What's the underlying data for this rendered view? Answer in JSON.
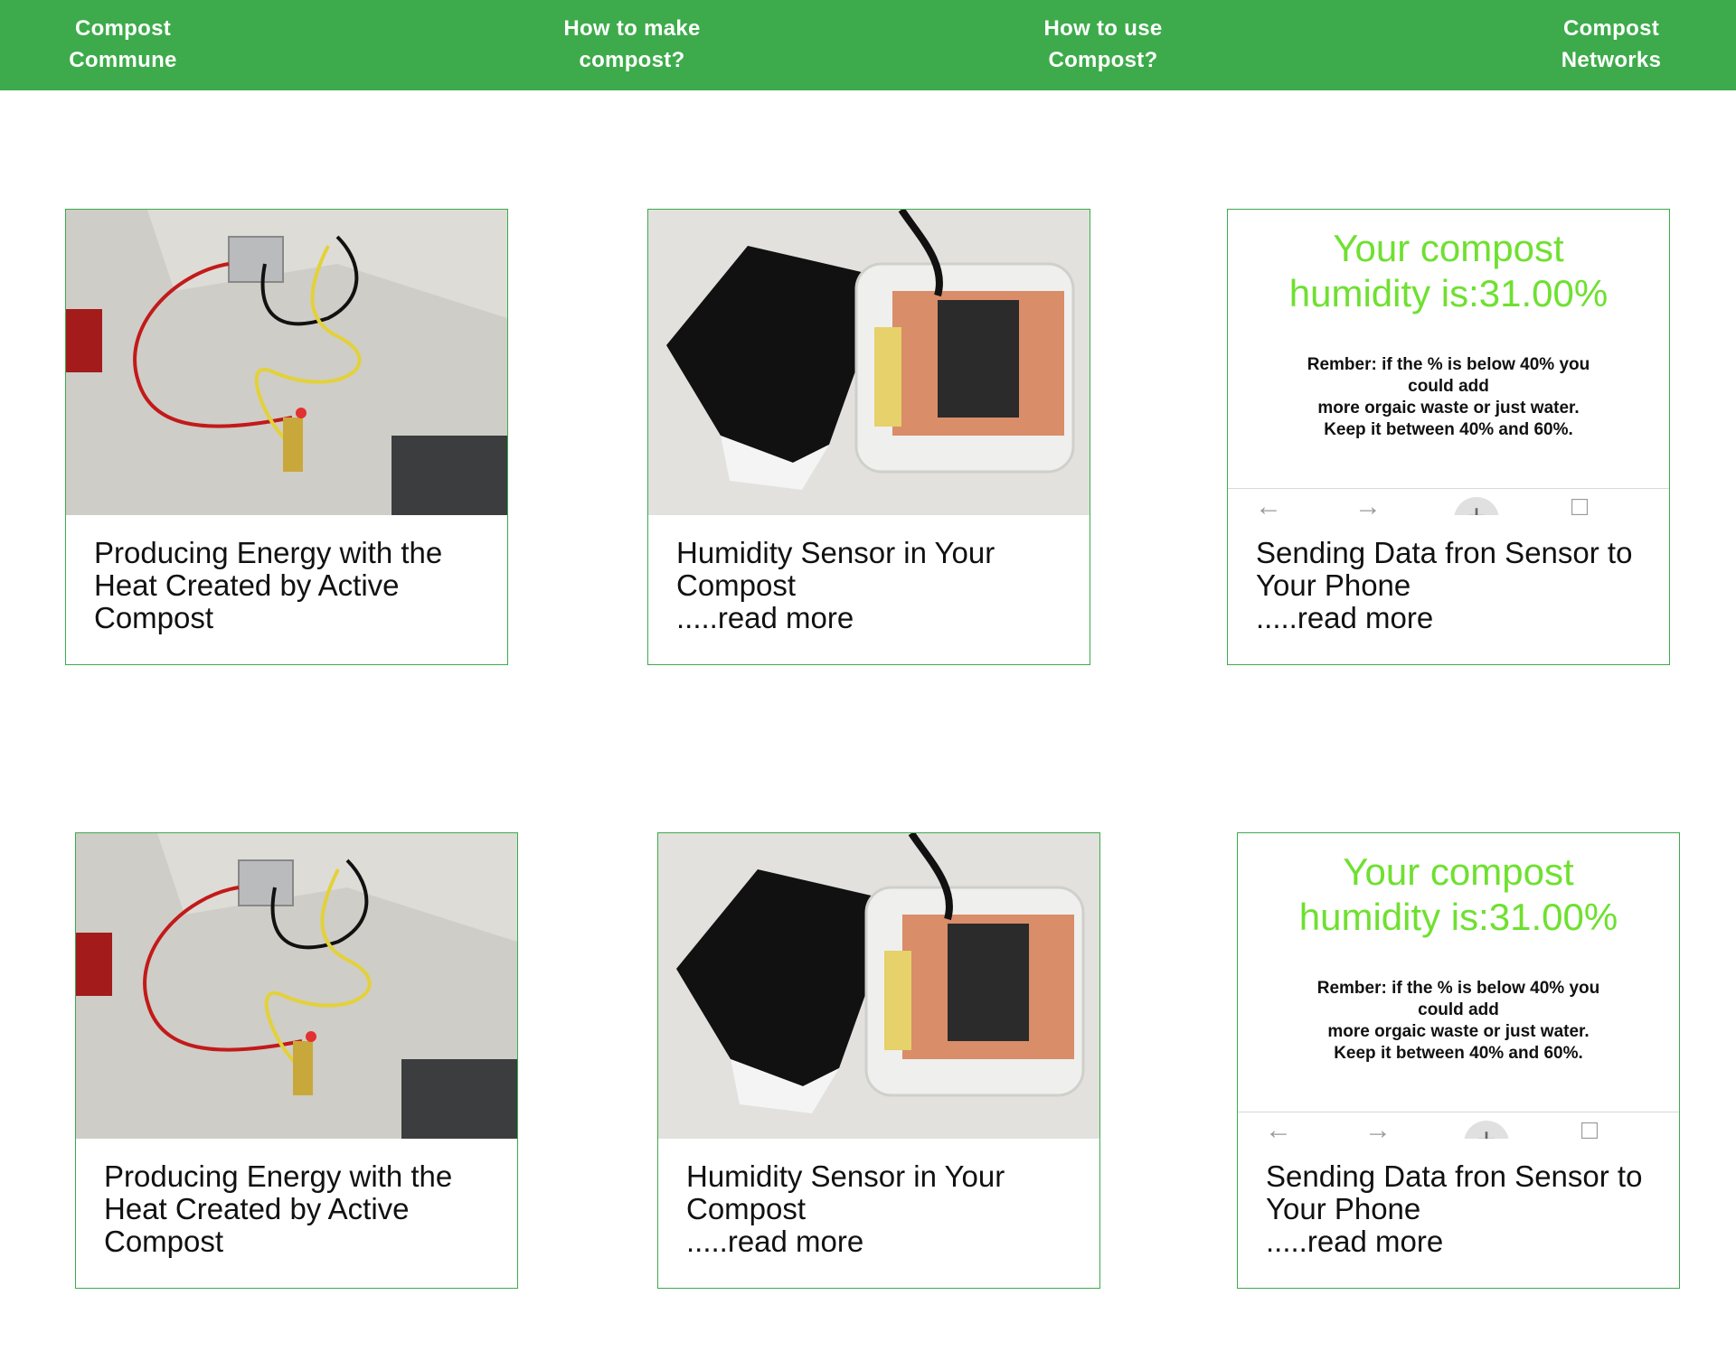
{
  "nav": {
    "items": [
      {
        "line1": "Compost",
        "line2": "Commune"
      },
      {
        "line1": "How to make",
        "line2": "compost?"
      },
      {
        "line1": "How to use",
        "line2": "Compost?"
      },
      {
        "line1": "Compost",
        "line2": "Networks"
      }
    ]
  },
  "rows": [
    {
      "cards": [
        {
          "line1": "Producing Energy with the",
          "line2": "Heat Created by Active",
          "line3": "Compost"
        },
        {
          "line1": "Humidity Sensor in Your",
          "line2": "Compost",
          "line3": ".....read more"
        },
        {
          "line1": "Sending Data fron Sensor to",
          "line2": "Your Phone",
          "line3": ".....read more",
          "screen": {
            "big1": "Your compost",
            "big2": "humidity is:31.00%",
            "small1": "Rember: if the % is below 40% you",
            "small2": "could add",
            "small3": "more orgaic waste or just water.",
            "small4": "Keep it between 40% and 60%."
          }
        }
      ]
    },
    {
      "cards": [
        {
          "line1": "Producing Energy with the",
          "line2": "Heat Created by Active",
          "line3": "Compost"
        },
        {
          "line1": "Humidity Sensor in Your",
          "line2": "Compost",
          "line3": ".....read more"
        },
        {
          "line1": "Sending Data fron Sensor to",
          "line2": "Your Phone",
          "line3": ".....read more",
          "screen": {
            "big1": "Your compost",
            "big2": "humidity is:31.00%",
            "small1": "Rember: if the % is below 40% you",
            "small2": "could add",
            "small3": "more orgaic waste or just water.",
            "small4": "Keep it between 40% and 60%."
          }
        }
      ]
    }
  ],
  "colors": {
    "brand_green": "#3dab4b",
    "screen_green": "#6fe030"
  }
}
